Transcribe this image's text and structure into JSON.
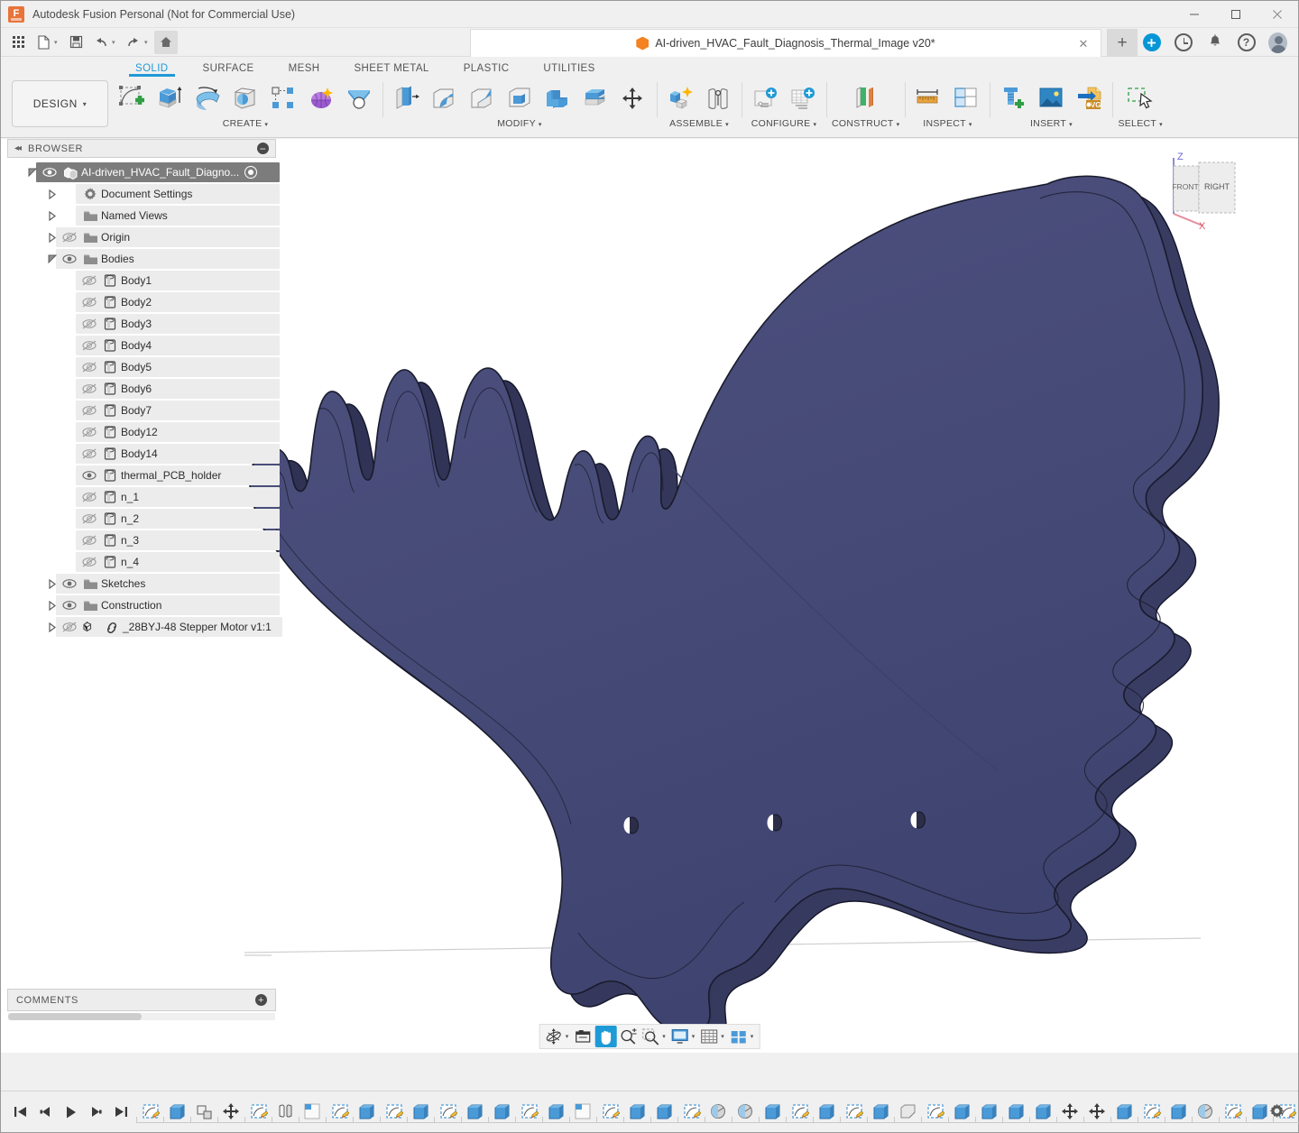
{
  "window": {
    "title": "Autodesk Fusion Personal (Not for Commercial Use)",
    "minimize": "—",
    "maximize": "☐",
    "close": "✕"
  },
  "quick_access": {
    "grid": "grid-icon",
    "new": "new-document",
    "save": "save",
    "undo": "undo",
    "redo": "redo",
    "home": "home",
    "caret": "▾"
  },
  "document_tab": {
    "label": "AI-driven_HVAC_Fault_Diagnosis_Thermal_Image v20*",
    "close": "✕",
    "new_tab": "+"
  },
  "system_icons": {
    "extension": "+",
    "history": "clock-icon",
    "notifications": "bell-icon",
    "help": "?",
    "account": "avatar"
  },
  "ribbon": {
    "design_button": "DESIGN",
    "caret": "▾",
    "tabs": [
      {
        "label": "SOLID",
        "active": true
      },
      {
        "label": "SURFACE",
        "active": false
      },
      {
        "label": "MESH",
        "active": false
      },
      {
        "label": "SHEET METAL",
        "active": false
      },
      {
        "label": "PLASTIC",
        "active": false
      },
      {
        "label": "UTILITIES",
        "active": false
      }
    ],
    "groups": [
      {
        "label": "CREATE",
        "dropdown": true,
        "tools": [
          "create-sketch-icon",
          "extrude-icon",
          "revolve-icon",
          "sweep-icon",
          "pattern-icon",
          "form-icon",
          "loft-icon"
        ]
      },
      {
        "label": "MODIFY",
        "dropdown": true,
        "tools": [
          "press-pull-icon",
          "fillet-icon",
          "chamfer-icon",
          "shell-icon",
          "combine-icon",
          "offset-face-icon",
          "move-copy-icon"
        ]
      },
      {
        "label": "ASSEMBLE",
        "dropdown": true,
        "tools": [
          "new-component-icon",
          "joint-icon"
        ]
      },
      {
        "label": "CONFIGURE",
        "dropdown": true,
        "tools": [
          "configuration-icon",
          "configuration-table-icon"
        ]
      },
      {
        "label": "CONSTRUCT",
        "dropdown": true,
        "tools": [
          "offset-plane-icon"
        ]
      },
      {
        "label": "INSPECT",
        "dropdown": true,
        "tools": [
          "measure-icon",
          "section-analysis-icon"
        ]
      },
      {
        "label": "INSERT",
        "dropdown": true,
        "tools": [
          "insert-mcmaster-icon",
          "insert-image-icon",
          "insert-svg-icon"
        ]
      },
      {
        "label": "SELECT",
        "dropdown": true,
        "tools": [
          "select-window-icon"
        ]
      }
    ]
  },
  "browser": {
    "header": "BROWSER",
    "collapse_icon": "◂◂",
    "minimize_icon": "−",
    "nodes": [
      {
        "label": "AI-driven_HVAC_Fault_Diagno...",
        "indent": 0,
        "arrow": "expanded",
        "eye": "visible",
        "icon": "document-icon",
        "selected": true,
        "trailing": "radio-dot"
      },
      {
        "label": "Document Settings",
        "indent": 1,
        "arrow": "collapsed",
        "eye": "none",
        "icon": "gear-icon",
        "selected": false
      },
      {
        "label": "Named Views",
        "indent": 1,
        "arrow": "collapsed",
        "eye": "none",
        "icon": "folder-icon",
        "selected": false
      },
      {
        "label": "Origin",
        "indent": 1,
        "arrow": "collapsed",
        "eye": "hidden",
        "icon": "folder-icon",
        "selected": false
      },
      {
        "label": "Bodies",
        "indent": 1,
        "arrow": "expanded",
        "eye": "visible",
        "icon": "folder-icon",
        "selected": false
      },
      {
        "label": "Body1",
        "indent": 2,
        "arrow": "none",
        "eye": "hidden",
        "icon": "body-icon",
        "selected": false
      },
      {
        "label": "Body2",
        "indent": 2,
        "arrow": "none",
        "eye": "hidden",
        "icon": "body-icon",
        "selected": false
      },
      {
        "label": "Body3",
        "indent": 2,
        "arrow": "none",
        "eye": "hidden",
        "icon": "body-icon",
        "selected": false
      },
      {
        "label": "Body4",
        "indent": 2,
        "arrow": "none",
        "eye": "hidden",
        "icon": "body-icon",
        "selected": false
      },
      {
        "label": "Body5",
        "indent": 2,
        "arrow": "none",
        "eye": "hidden",
        "icon": "body-icon",
        "selected": false
      },
      {
        "label": "Body6",
        "indent": 2,
        "arrow": "none",
        "eye": "hidden",
        "icon": "body-icon",
        "selected": false
      },
      {
        "label": "Body7",
        "indent": 2,
        "arrow": "none",
        "eye": "hidden",
        "icon": "body-icon",
        "selected": false
      },
      {
        "label": "Body12",
        "indent": 2,
        "arrow": "none",
        "eye": "hidden",
        "icon": "body-icon",
        "selected": false
      },
      {
        "label": "Body14",
        "indent": 2,
        "arrow": "none",
        "eye": "hidden",
        "icon": "body-icon",
        "selected": false
      },
      {
        "label": "thermal_PCB_holder",
        "indent": 2,
        "arrow": "none",
        "eye": "visible",
        "icon": "body-icon",
        "selected": false
      },
      {
        "label": "n_1",
        "indent": 2,
        "arrow": "none",
        "eye": "hidden",
        "icon": "body-icon",
        "selected": false
      },
      {
        "label": "n_2",
        "indent": 2,
        "arrow": "none",
        "eye": "hidden",
        "icon": "body-icon",
        "selected": false
      },
      {
        "label": "n_3",
        "indent": 2,
        "arrow": "none",
        "eye": "hidden",
        "icon": "body-icon",
        "selected": false
      },
      {
        "label": "n_4",
        "indent": 2,
        "arrow": "none",
        "eye": "hidden",
        "icon": "body-icon",
        "selected": false
      },
      {
        "label": "Sketches",
        "indent": 1,
        "arrow": "collapsed",
        "eye": "visible",
        "icon": "folder-icon",
        "selected": false
      },
      {
        "label": "Construction",
        "indent": 1,
        "arrow": "collapsed",
        "eye": "visible",
        "icon": "folder-icon",
        "selected": false
      },
      {
        "label": "_28BYJ-48 Stepper Motor v1:1",
        "indent": 1,
        "arrow": "collapsed",
        "eye": "hidden",
        "icon": "component-link-icon",
        "selected": false
      }
    ]
  },
  "viewcube": {
    "front_face": "FRONT",
    "right_face": "RIGHT",
    "axis_z": "Z",
    "axis_x": "X"
  },
  "model": {
    "body_color": "#474a78",
    "edge_color": "#1b1d2e",
    "shadow_color": "#c9c9c9"
  },
  "navbar": {
    "items": [
      {
        "name": "orbit",
        "caret": true,
        "active": false
      },
      {
        "name": "pan-view-toolbar",
        "caret": false,
        "active": false
      },
      {
        "name": "pan",
        "caret": false,
        "active": true
      },
      {
        "name": "zoom",
        "caret": false,
        "active": false
      },
      {
        "name": "zoom-window",
        "caret": true,
        "active": false
      },
      {
        "name": "display-settings",
        "caret": true,
        "active": false
      },
      {
        "name": "grid-settings",
        "caret": true,
        "active": false
      },
      {
        "name": "viewports",
        "caret": true,
        "active": false
      }
    ],
    "caret": "▾"
  },
  "comments": {
    "label": "COMMENTS",
    "add": "+"
  },
  "timeline": {
    "playback": [
      "go-to-beginning",
      "step-back",
      "play",
      "step-forward",
      "go-to-end"
    ],
    "settings": "timeline-settings-gear",
    "features": [
      "sketch",
      "extrude",
      "component",
      "move-copy",
      "sketch",
      "joint",
      "construction-plane",
      "sketch",
      "extrude",
      "sketch",
      "extrude",
      "sketch",
      "extrude",
      "extrude",
      "sketch",
      "extrude",
      "construction-plane",
      "sketch",
      "extrude",
      "extrude",
      "sketch",
      "revolve",
      "revolve",
      "extrude",
      "sketch",
      "extrude",
      "sketch",
      "extrude",
      "chamfer",
      "sketch",
      "extrude",
      "extrude",
      "extrude",
      "extrude",
      "move-copy",
      "move-copy",
      "extrude",
      "sketch",
      "extrude",
      "revolve",
      "sketch",
      "extrude",
      "sketch",
      "extrude",
      "sketch",
      "extrude",
      "extrude",
      "sketch",
      "extrude",
      "sketch",
      "extrude",
      "chamfer"
    ]
  }
}
